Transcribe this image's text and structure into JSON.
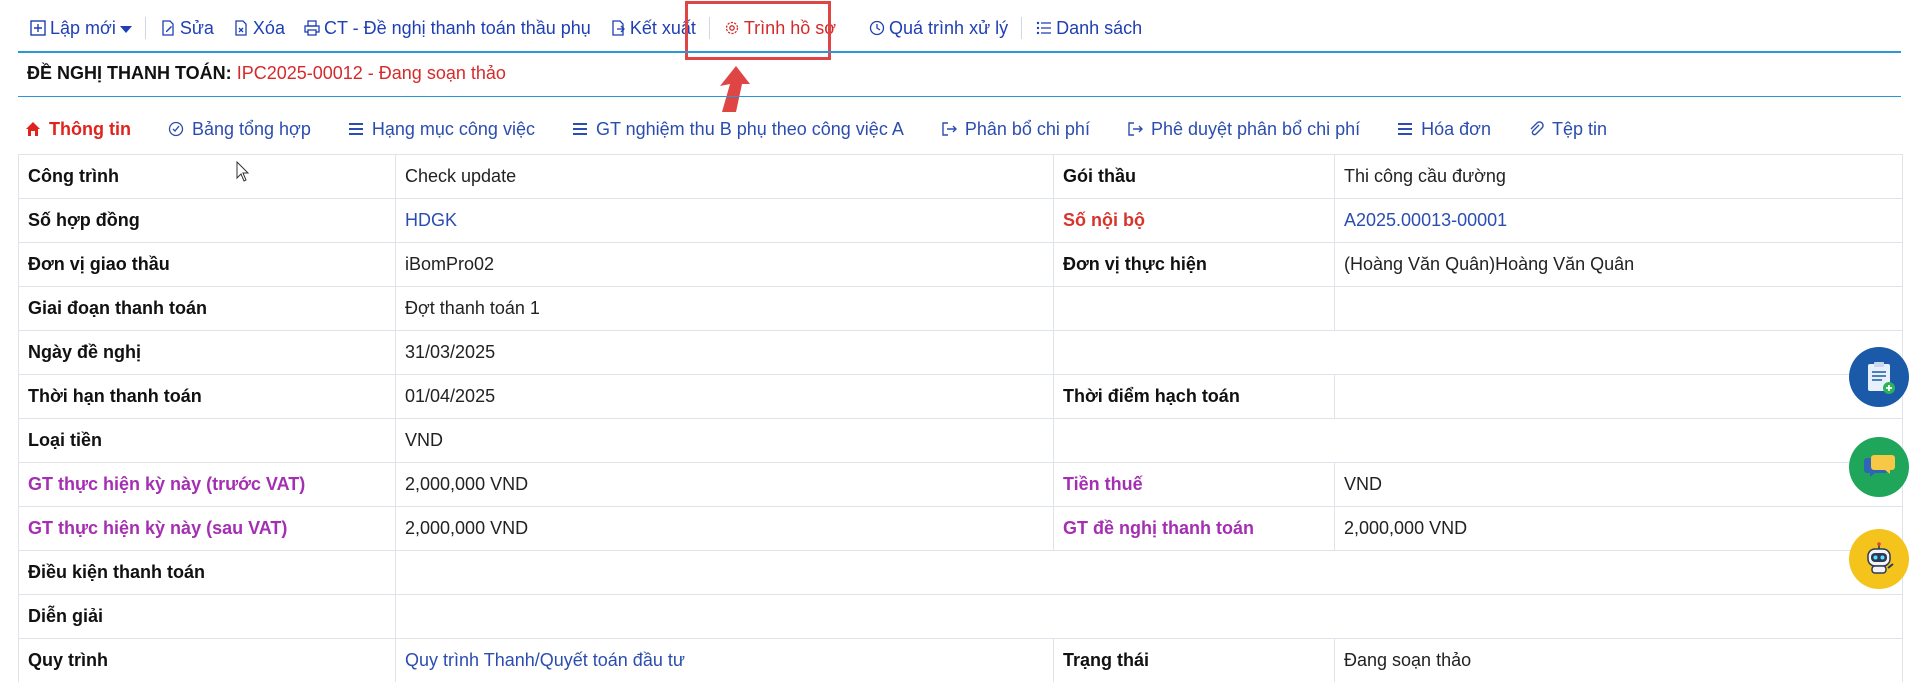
{
  "toolbar": {
    "new_label": "Lập mới",
    "edit_label": "Sửa",
    "delete_label": "Xóa",
    "print_label": "CT - Đề nghị thanh toán thầu phụ",
    "export_label": "Kết xuất",
    "submit_label": "Trình hồ sơ",
    "process_label": "Quá trình xử lý",
    "list_label": "Danh sách"
  },
  "header": {
    "label": "ĐỀ NGHỊ THANH TOÁN:",
    "value": "IPC2025-00012 - Đang soạn thảo"
  },
  "tabs": [
    {
      "label": "Thông tin",
      "active": true
    },
    {
      "label": "Bảng tổng hợp"
    },
    {
      "label": "Hạng mục công việc"
    },
    {
      "label": "GT nghiệm thu B phụ theo công việc A"
    },
    {
      "label": "Phân bổ chi phí"
    },
    {
      "label": "Phê duyệt phân bổ chi phí"
    },
    {
      "label": "Hóa đơn"
    },
    {
      "label": "Tệp tin"
    }
  ],
  "rows": [
    {
      "l1": "Công trình",
      "v1": "Check update",
      "l2": "Gói thầu",
      "v2": "Thi công cầu đường"
    },
    {
      "l1": "Số hợp đồng",
      "v1": "HDGK",
      "l2": "Số nội bộ",
      "v2": "A2025.00013-00001"
    },
    {
      "l1": "Đơn vị giao thầu",
      "v1": "iBomPro02",
      "l2": "Đơn vị thực hiện",
      "v2": "(Hoàng Văn Quân)Hoàng Văn Quân"
    },
    {
      "l1": "Giai đoạn thanh toán",
      "v1": "Đợt thanh toán 1",
      "l2": "",
      "v2": ""
    },
    {
      "l1": "Ngày đề nghị",
      "v1": "31/03/2025"
    },
    {
      "l1": "Thời hạn thanh toán",
      "v1": "01/04/2025",
      "l2": "Thời điểm hạch toán",
      "v2": ""
    },
    {
      "l1": "Loại tiền",
      "v1": "VND"
    },
    {
      "l1": "GT thực hiện kỳ này (trước VAT)",
      "v1": "2,000,000 VND",
      "l2": "Tiền thuế",
      "v2": "VND"
    },
    {
      "l1": "GT thực hiện kỳ này (sau VAT)",
      "v1": "2,000,000 VND",
      "l2": "GT đề nghị thanh toán",
      "v2": "2,000,000 VND"
    },
    {
      "l1": "Điều kiện thanh toán",
      "v1": ""
    },
    {
      "l1": "Diễn giải",
      "v1": ""
    },
    {
      "l1": "Quy trình",
      "v1": "Quy trình Thanh/Quyết toán đầu tư",
      "l2": "Trạng thái",
      "v2": "Đang soạn thảo"
    }
  ],
  "colors": {
    "link": "#2c4db0",
    "active_tab": "#e0231c",
    "status_red": "#d62a2a",
    "label_purple": "#a52fb2",
    "highlight_border": "#e04545",
    "rule_blue": "#2a97d8"
  }
}
